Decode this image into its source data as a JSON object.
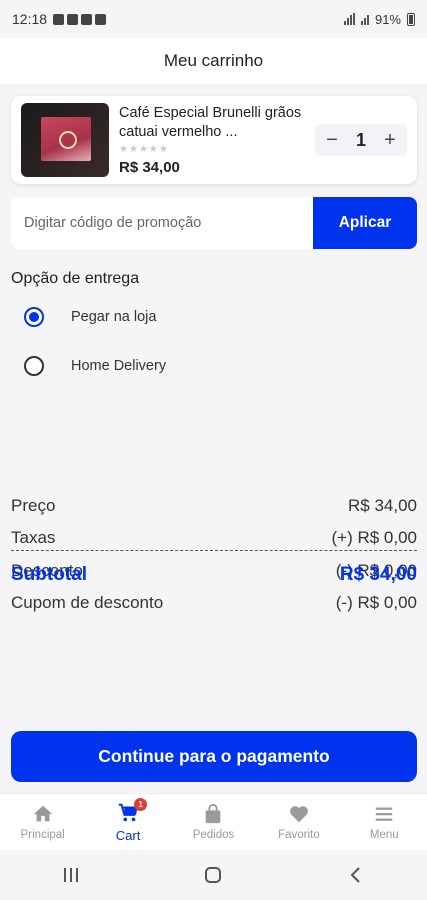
{
  "status_bar": {
    "time": "12:18",
    "battery": "91%"
  },
  "header": {
    "title": "Meu carrinho"
  },
  "cart": {
    "items": [
      {
        "name": "Café Especial Brunelli grãos catuai vermelho ...",
        "price": "R$ 34,00",
        "quantity": "1",
        "rating": 0
      }
    ]
  },
  "promo": {
    "placeholder": "Digitar código de promoção",
    "apply_label": "Aplicar"
  },
  "delivery": {
    "title": "Opção de entrega",
    "options": [
      {
        "label": "Pegar na loja",
        "selected": true
      },
      {
        "label": "Home Delivery",
        "selected": false
      }
    ]
  },
  "summary": {
    "rows": [
      {
        "label": "Preço",
        "value": "R$ 34,00"
      },
      {
        "label": "Taxas",
        "value": "(+) R$ 0,00"
      },
      {
        "label": "Desconto",
        "value": "(-) R$ 0,00"
      },
      {
        "label": "Cupom de desconto",
        "value": "(-) R$ 0,00"
      }
    ],
    "subtotal_label": "Subtotal",
    "subtotal_value": "R$ 34,00"
  },
  "checkout": {
    "label": "Continue para o pagamento"
  },
  "bottom_nav": {
    "items": [
      {
        "label": "Principal",
        "icon": "home-icon"
      },
      {
        "label": "Cart",
        "icon": "cart-icon",
        "badge": "1",
        "active": true
      },
      {
        "label": "Pedidos",
        "icon": "bag-icon"
      },
      {
        "label": "Favorito",
        "icon": "heart-icon"
      },
      {
        "label": "Menu",
        "icon": "menu-icon"
      }
    ]
  },
  "colors": {
    "primary": "#0033ee",
    "background": "#f5f5f7",
    "badge": "#e53935"
  }
}
